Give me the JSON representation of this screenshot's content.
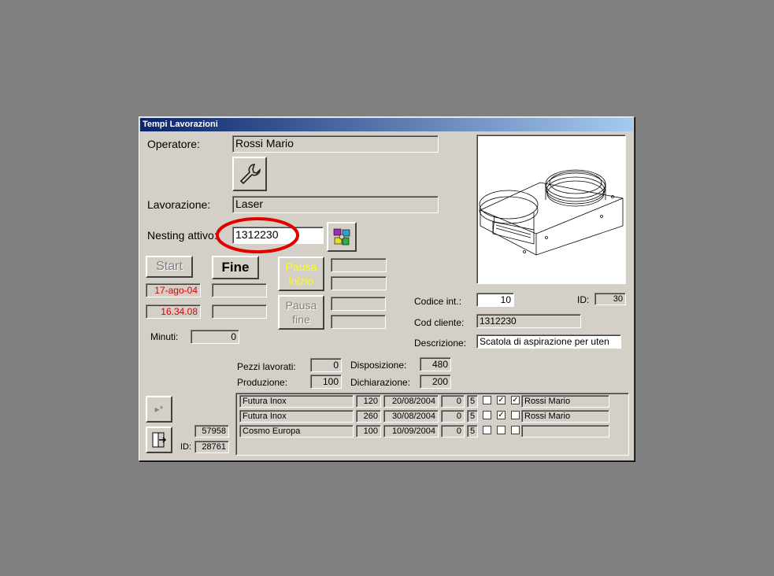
{
  "window": {
    "title": "Tempi Lavorazioni"
  },
  "form": {
    "operatore_label": "Operatore:",
    "operatore_value": "Rossi Mario",
    "lavorazione_label": "Lavorazione:",
    "lavorazione_value": "Laser",
    "nesting_label": "Nesting attivo:",
    "nesting_value": "1312230",
    "start_label": "Start",
    "fine_label": "Fine",
    "pausa_inizio_label": "Pausa inizio",
    "pausa_fine_label": "Pausa fine",
    "start_date": "17-ago-04",
    "start_time": "16.34.08",
    "minuti_label": "Minuti:",
    "minuti_value": "0"
  },
  "details": {
    "codice_int_label": "Codice  int.:",
    "codice_int_value": "10",
    "id_label": "ID:",
    "id_value": "30",
    "cod_cliente_label": "Cod cliente:",
    "cod_cliente_value": "1312230",
    "descrizione_label": "Descrizione:",
    "descrizione_value": "Scatola di aspirazione per uten",
    "pezzi_lavorati_label": "Pezzi lavorati:",
    "pezzi_lavorati_value": "0",
    "disposizione_label": "Disposizione:",
    "disposizione_value": "480",
    "produzione_label": "Produzione:",
    "produzione_value": "100",
    "dichiarazione_label": "Dichiarazione:",
    "dichiarazione_value": "200"
  },
  "footer": {
    "record_value": "57958",
    "id_label": "ID:",
    "id_value": "28761"
  },
  "icons": {
    "wrench": "wrench-icon",
    "nesting": "nesting-icon",
    "new_record": "new-record-icon",
    "exit": "exit-door-icon",
    "drawing": "part-drawing"
  },
  "rows": [
    {
      "cliente": "Futura Inox",
      "qta": "120",
      "data": "20/08/2004",
      "v1": "0",
      "v2": "5",
      "c1": false,
      "c2": true,
      "c3": true,
      "operatore": "Rossi Mario"
    },
    {
      "cliente": "Futura Inox",
      "qta": "260",
      "data": "30/08/2004",
      "v1": "0",
      "v2": "5",
      "c1": false,
      "c2": true,
      "c3": false,
      "operatore": "Rossi Mario"
    },
    {
      "cliente": "Cosmo Europa",
      "qta": "100",
      "data": "10/09/2004",
      "v1": "0",
      "v2": "5",
      "c1": false,
      "c2": false,
      "c3": false,
      "operatore": ""
    }
  ],
  "colors": {
    "face": "#d4d0c8",
    "title_start": "#0a246a",
    "title_end": "#a6caf0",
    "highlight_circle": "#e00000",
    "disabled_yellow": "#ffff00"
  }
}
